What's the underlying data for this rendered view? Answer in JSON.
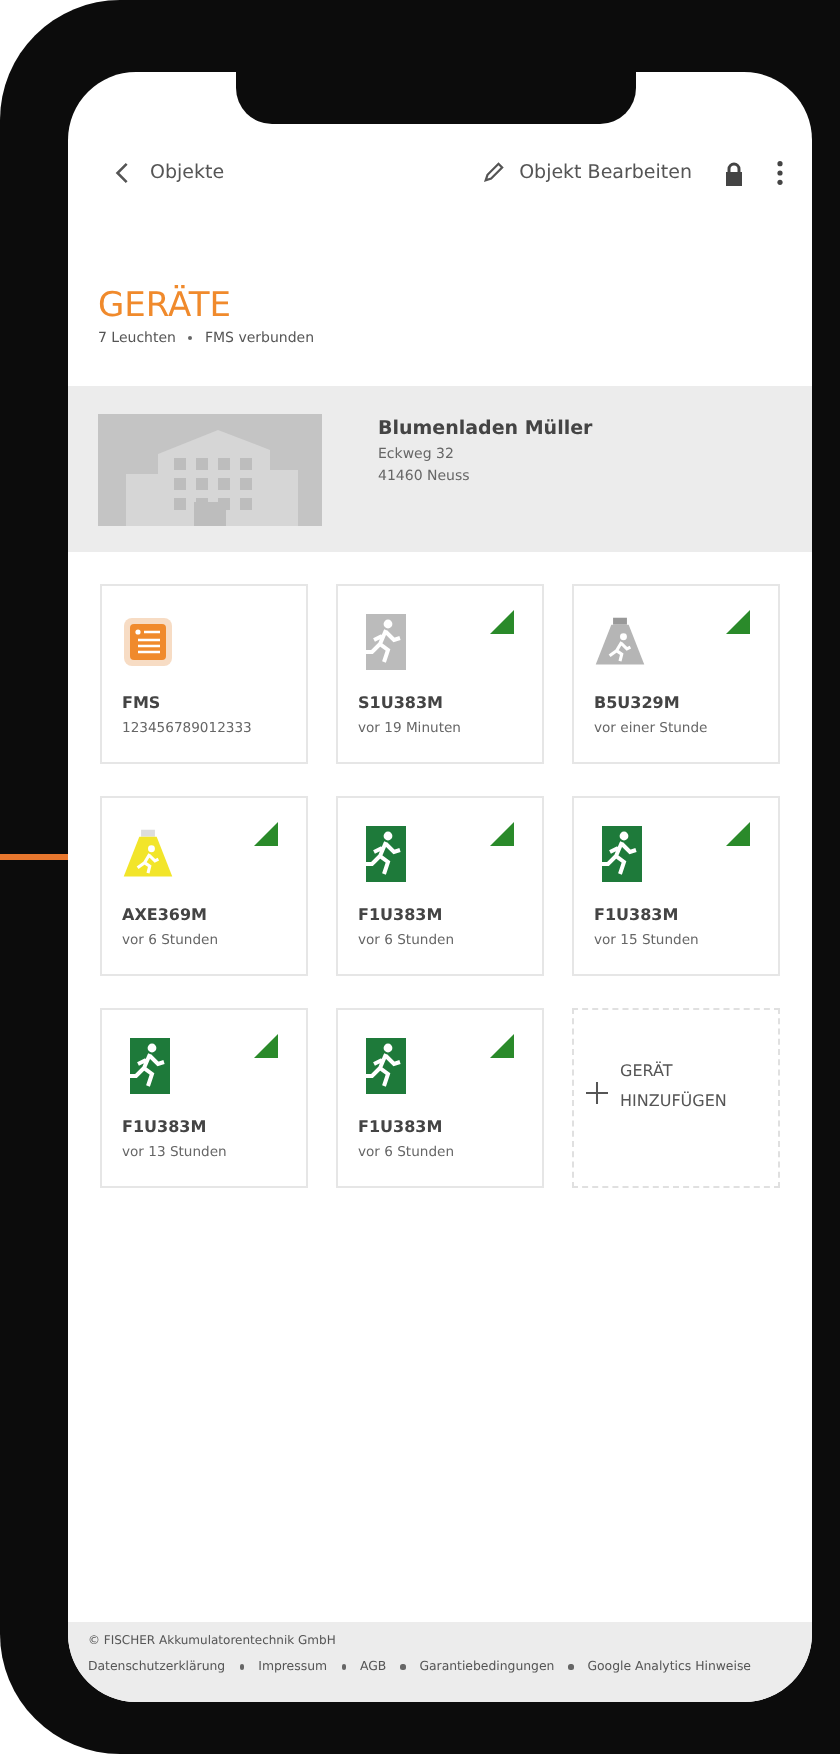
{
  "header": {
    "back_label": "Objekte",
    "edit_label": "Objekt Bearbeiten"
  },
  "title": "GERÄTE",
  "subtitle": [
    "7 Leuchten",
    "FMS verbunden"
  ],
  "location": {
    "name": "Blumenladen Müller",
    "street": "Eckweg 32",
    "city": "41460 Neuss"
  },
  "devices": [
    {
      "kind": "fms",
      "name": "FMS",
      "detail": "123456789012333",
      "connected": false
    },
    {
      "kind": "exit-gray",
      "name": "S1U383M",
      "detail": "vor 19 Minuten",
      "connected": true
    },
    {
      "kind": "lamp-gray",
      "name": "B5U329M",
      "detail": "vor einer Stunde",
      "connected": true
    },
    {
      "kind": "lamp-yellow",
      "name": "AXE369M",
      "detail": "vor 6 Stunden",
      "connected": true
    },
    {
      "kind": "exit-green",
      "name": "F1U383M",
      "detail": "vor 6 Stunden",
      "connected": true
    },
    {
      "kind": "exit-green",
      "name": "F1U383M",
      "detail": "vor 15 Stunden",
      "connected": true
    },
    {
      "kind": "exit-green",
      "name": "F1U383M",
      "detail": "vor 13 Stunden",
      "connected": true
    },
    {
      "kind": "exit-green",
      "name": "F1U383M",
      "detail": "vor 6 Stunden",
      "connected": true
    }
  ],
  "add_device": [
    "GERÄT",
    "HINZUFÜGEN"
  ],
  "footer": {
    "copyright": "© FISCHER Akkumulatorentechnik GmbH",
    "links": [
      "Datenschutzerklärung",
      "Impressum",
      "AGB",
      "Garantiebedingungen",
      "Google Analytics Hinweise"
    ]
  }
}
